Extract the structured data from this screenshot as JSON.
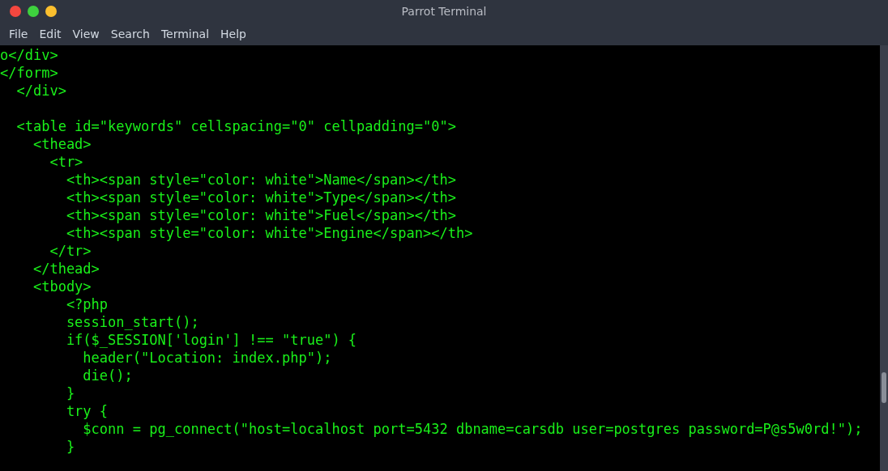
{
  "window": {
    "title": "Parrot Terminal"
  },
  "menu": [
    "File",
    "Edit",
    "View",
    "Search",
    "Terminal",
    "Help"
  ],
  "terminal": {
    "lines": [
      {
        "kind": "code",
        "text": "o</div>"
      },
      {
        "kind": "code",
        "text": "</form>"
      },
      {
        "kind": "code",
        "text": "  </div>"
      },
      {
        "kind": "blank"
      },
      {
        "kind": "code",
        "text": "  <table id=\"keywords\" cellspacing=\"0\" cellpadding=\"0\">"
      },
      {
        "kind": "code",
        "text": "    <thead>"
      },
      {
        "kind": "code",
        "text": "      <tr>"
      },
      {
        "kind": "code",
        "text": "        <th><span style=\"color: white\">Name</span></th>"
      },
      {
        "kind": "code",
        "text": "        <th><span style=\"color: white\">Type</span></th>"
      },
      {
        "kind": "code",
        "text": "        <th><span style=\"color: white\">Fuel</span></th>"
      },
      {
        "kind": "code",
        "text": "        <th><span style=\"color: white\">Engine</span></th>"
      },
      {
        "kind": "code",
        "text": "      </tr>"
      },
      {
        "kind": "code",
        "text": "    </thead>"
      },
      {
        "kind": "code",
        "text": "    <tbody>"
      },
      {
        "kind": "code",
        "text": "        <?php"
      },
      {
        "kind": "code",
        "text": "        session_start();"
      },
      {
        "kind": "code",
        "text": "        if($_SESSION['login'] !== \"true\") {"
      },
      {
        "kind": "code",
        "text": "          header(\"Location: index.php\");"
      },
      {
        "kind": "code",
        "text": "          die();"
      },
      {
        "kind": "code",
        "text": "        }"
      },
      {
        "kind": "code",
        "text": "        try {"
      },
      {
        "kind": "code",
        "text": "          $conn = pg_connect(\"host=localhost port=5432 dbname=carsdb user=postgres password=P@s5w0rd!\");"
      },
      {
        "kind": "code",
        "text": "        }"
      }
    ]
  }
}
